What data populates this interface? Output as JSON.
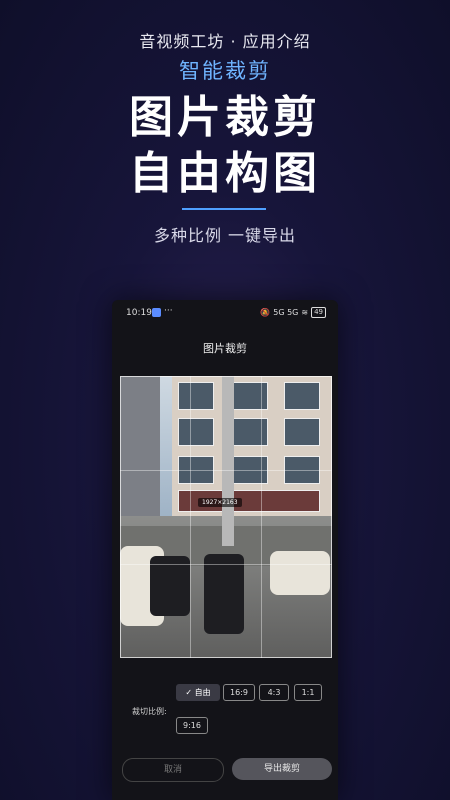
{
  "promo": {
    "subtitle": "音视频工坊 · 应用介绍",
    "feature_tag": "智能裁剪",
    "headline_line1": "图片裁剪",
    "headline_line2": "自由构图",
    "tagline": "多种比例 一键导出"
  },
  "status_bar": {
    "time": "10:19",
    "dots": "···",
    "signal": "5G 5G",
    "battery": "49"
  },
  "screen": {
    "title": "图片裁剪",
    "image_size_label": "1927×2163",
    "ratio_label": "裁切比例:",
    "ratios": [
      {
        "label": "✓ 自由",
        "active": true
      },
      {
        "label": "16:9",
        "active": false
      },
      {
        "label": "4:3",
        "active": false
      },
      {
        "label": "1:1",
        "active": false
      },
      {
        "label": "9:16",
        "active": false
      }
    ],
    "cancel_label": "取消",
    "export_label": "导出裁剪"
  },
  "colors": {
    "accent": "#4fa0ff",
    "feature_tag": "#6fb4ff",
    "background": "#17153a"
  }
}
